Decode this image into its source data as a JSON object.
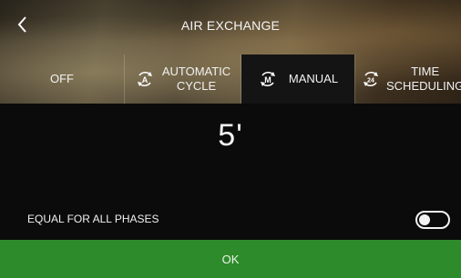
{
  "header": {
    "title": "AIR EXCHANGE",
    "back_icon": "chevron-left-icon"
  },
  "tabs": [
    {
      "label": "OFF",
      "icon": "",
      "selected": false
    },
    {
      "label_line1": "AUTOMATIC",
      "label_line2": "CYCLE",
      "icon": "recycle-a-icon",
      "selected": false
    },
    {
      "label": "MANUAL",
      "icon": "recycle-m-icon",
      "selected": true
    },
    {
      "label_line1": "TIME",
      "label_line2": "SCHEDULING",
      "icon": "recycle-24-icon",
      "selected": false
    }
  ],
  "main": {
    "value": "5'",
    "equal_phases_label": "EQUAL FOR ALL PHASES",
    "equal_phases_enabled": false
  },
  "footer": {
    "ok_label": "OK"
  },
  "colors": {
    "ok_green": "#2e8b2b",
    "background": "#0b0b0b",
    "selected_tab": "#141414"
  }
}
